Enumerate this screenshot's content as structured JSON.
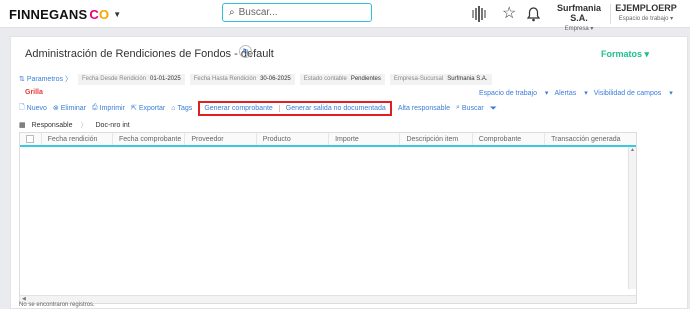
{
  "header": {
    "brand": "FINNEGANS",
    "brand_co_1": "C",
    "brand_co_2": "O",
    "search_placeholder": "Buscar...",
    "company_name": "Surfmania S.A.",
    "company_sub": "Empresa",
    "workspace_name": "EJEMPLOERP",
    "workspace_sub": "Espacio de trabajo"
  },
  "page": {
    "title": "Administración de Rendiciones de Fondos - default",
    "formatos": "Formatos"
  },
  "params": {
    "link": "Parametros",
    "filters": [
      {
        "label": "Fecha Desde Rendición",
        "value": "01-01-2025"
      },
      {
        "label": "Fecha Hasta Rendición",
        "value": "30-06-2025"
      },
      {
        "label": "Estado contable",
        "value": "Pendientes"
      },
      {
        "label": "Empresa-Sucursal",
        "value": "Surfmania S.A."
      }
    ]
  },
  "grilla_label": "Grilla",
  "right_menus": [
    "Espacio de trabajo",
    "Alertas",
    "Visibilidad de campos"
  ],
  "toolbar": {
    "nuevo": "Nuevo",
    "eliminar": "Eliminar",
    "imprimir": "Imprimir",
    "exportar": "Exportar",
    "tags": "Tags",
    "generar_comprobante": "Generar comprobante",
    "generar_salida": "Generar salida no documentada",
    "alta_responsable": "Alta responsable",
    "buscar": "Buscar"
  },
  "groupbar": {
    "responsable": "Responsable",
    "docnro": "Doc-nro int"
  },
  "grid": {
    "columns": [
      "Fecha rendición",
      "Fecha comprobante",
      "Proveedor",
      "Producto",
      "Importe",
      "Descripción item",
      "Comprobante",
      "Transacción generada"
    ]
  },
  "footer": {
    "no_records": "No se encontraron registros."
  },
  "colors": {
    "accent": "#3b7dd8",
    "highlight_border": "#e02020",
    "grilla": "#e53935",
    "formatos": "#1fbf8f",
    "search_border": "#30c0d8"
  }
}
